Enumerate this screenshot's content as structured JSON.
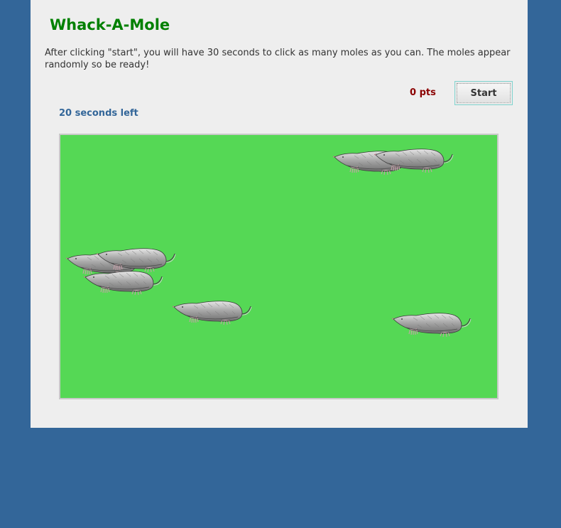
{
  "title": "Whack-A-Mole",
  "instructions": "After clicking \"start\", you will have 30 seconds to click as many moles as you can. The moles appear randomly so be ready!",
  "score": {
    "label": "0 pts"
  },
  "start_button": {
    "label": "Start"
  },
  "timer": {
    "label": "20 seconds left"
  },
  "colors": {
    "background": "#336699",
    "panel": "#eeeeee",
    "title": "#008000",
    "score": "#8b0000",
    "timer": "#336699",
    "field": "#55d855"
  },
  "moles": {
    "icon": "mole-icon",
    "count": 8
  }
}
